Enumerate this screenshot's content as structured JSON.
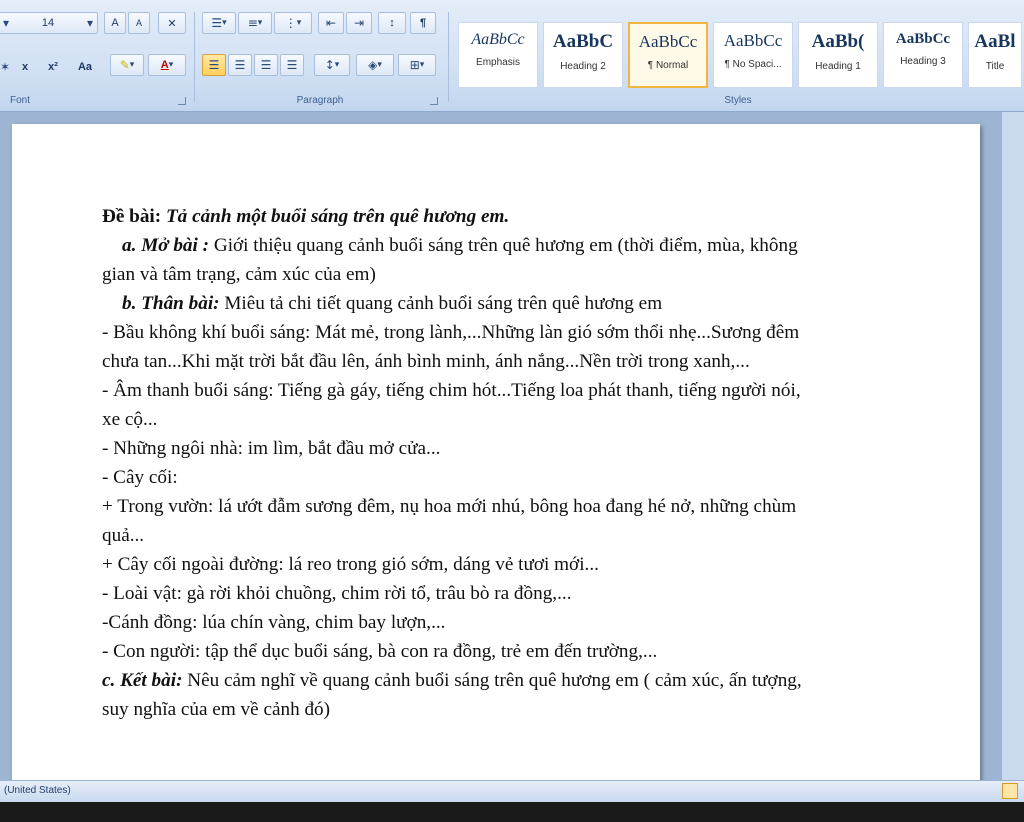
{
  "ribbon": {
    "font": {
      "size": "14",
      "grow_label": "A",
      "shrink_label": "A",
      "clear_label": "✕",
      "strike_label": "x",
      "subscript_label": "x",
      "superscript_label": "x²",
      "case_label": "Aa",
      "font_color_label": "A",
      "group_label": "Font"
    },
    "paragraph": {
      "sort_label": "↕",
      "show_marks_label": "¶",
      "group_label": "Paragraph"
    },
    "styles": {
      "items": [
        {
          "sample": "AaBbCc",
          "name": "Emphasis"
        },
        {
          "sample": "AaBbC",
          "name": "Heading 2"
        },
        {
          "sample": "AaBbCc",
          "name": "¶ Normal"
        },
        {
          "sample": "AaBbCc",
          "name": "¶ No Spaci..."
        },
        {
          "sample": "AaBb(",
          "name": "Heading 1"
        },
        {
          "sample": "AaBbCc",
          "name": "Heading 3"
        },
        {
          "sample": "AaBl",
          "name": "Title"
        }
      ],
      "active_index": 2,
      "group_label": "Styles"
    }
  },
  "document": {
    "title_label": "Đề bài:",
    "title_text": "Tả cảnh  một buổi sáng trên quê hương em.",
    "mo_bai_label": "a. Mở bài :",
    "mo_bai_text": " Giới thiệu  quang cảnh buổi sáng trên quê hương em (thời điểm, mùa, không",
    "mo_bai_text_2": "gian và tâm trạng, cảm xúc của em)",
    "than_bai_label": "b. Thân bài:",
    "than_bai_text": " Miêu tả chi tiết quang cảnh buổi sáng trên quê hương em",
    "lines": [
      "- Bầu không khí buổi sáng: Mát mẻ, trong lành,...Những làn gió sớm thổi nhẹ...Sương đêm",
      "chưa tan...Khi mặt trời bắt đầu lên, ánh bình minh, ánh nắng...Nền trời trong xanh,...",
      "- Âm thanh buổi sáng: Tiếng gà gáy, tiếng chim hót...Tiếng loa phát thanh, tiếng người nói,",
      "xe cộ...",
      "- Những  ngôi nhà: im lìm, bắt đầu mở cửa...",
      "- Cây cối:",
      "+ Trong vườn: lá ướt đẫm sương đêm, nụ hoa mới nhú, bông hoa đang hé nở, những chùm",
      "quả...",
      "+ Cây cối ngoài đường: lá reo trong gió sớm, dáng vẻ tươi mới...",
      "- Loài vật: gà rời khỏi chuồng, chim rời tổ, trâu bò ra đồng,...",
      "-Cánh đồng: lúa chín vàng, chim bay lượn,...",
      "- Con người: tập thể dục buổi sáng, bà con ra đồng, trẻ em đến trường,..."
    ],
    "ket_bai_label": "c. Kết bài:",
    "ket_bai_text": " Nêu cảm nghĩ về quang cảnh buổi sáng trên quê hương em ( cảm xúc, ấn tượng,",
    "ket_bai_text_2": "suy nghĩa của em về cảnh đó)"
  },
  "status_bar": {
    "language": "(United States)"
  }
}
